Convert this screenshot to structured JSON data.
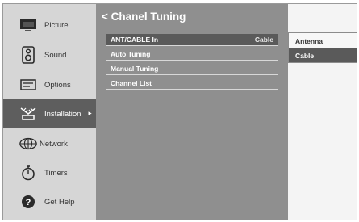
{
  "sidebar": {
    "items": [
      {
        "label": "Picture",
        "icon": "tv-icon",
        "active": false
      },
      {
        "label": "Sound",
        "icon": "speaker-icon",
        "active": false
      },
      {
        "label": "Options",
        "icon": "options-icon",
        "active": false
      },
      {
        "label": "Installation",
        "icon": "antenna-icon",
        "active": true,
        "arrow": "►"
      },
      {
        "label": "Network",
        "icon": "network-icon",
        "active": false
      },
      {
        "label": "Timers",
        "icon": "timer-icon",
        "active": false
      },
      {
        "label": "Get Help",
        "icon": "help-icon",
        "active": false
      }
    ]
  },
  "main": {
    "title": "< Chanel Tuning",
    "rows": [
      {
        "label": "ANT/CABLE In",
        "value": "Cable",
        "selected": true
      },
      {
        "label": "Auto Tuning",
        "value": "",
        "selected": false
      },
      {
        "label": "Manual Tuning",
        "value": "",
        "selected": false
      },
      {
        "label": "Channel List",
        "value": "",
        "selected": false
      }
    ]
  },
  "popup": {
    "options": [
      {
        "label": "Antenna",
        "selected": false
      },
      {
        "label": "Cable",
        "selected": true
      }
    ]
  },
  "colors": {
    "sidebar_bg": "#d6d6d6",
    "active_item_bg": "#5e5e5e",
    "main_bg": "#8f8f8f",
    "selected_row_bg": "#5a5a5a"
  }
}
